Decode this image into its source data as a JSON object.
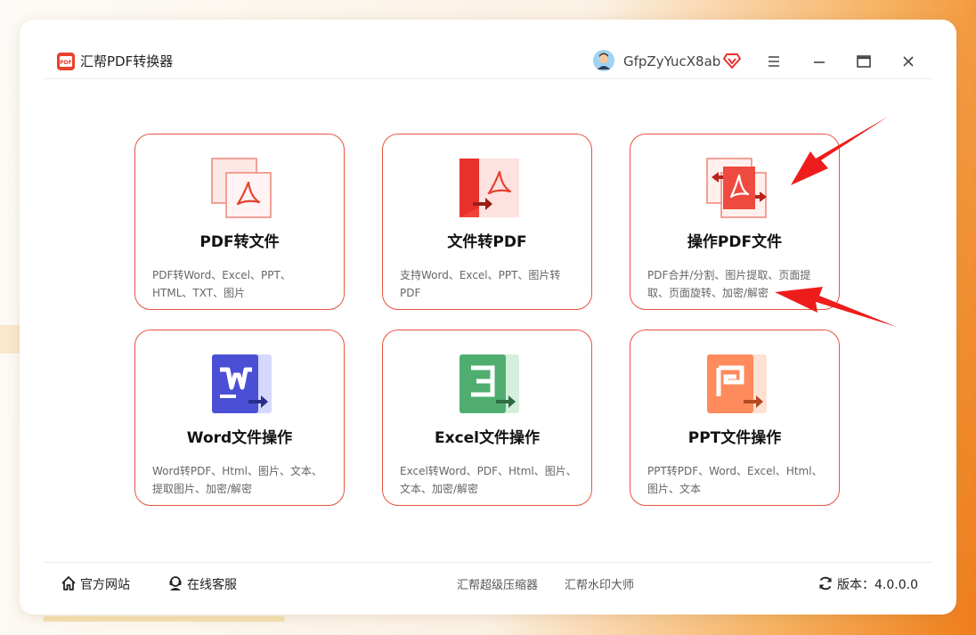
{
  "app": {
    "title": "汇帮PDF转换器",
    "logo_text": "PDF"
  },
  "user": {
    "name": "GfpZyYucX8ab"
  },
  "cards": [
    {
      "title": "PDF转文件",
      "desc": "PDF转Word、Excel、PPT、HTML、TXT、图片",
      "icon": "pdf-to-file-icon"
    },
    {
      "title": "文件转PDF",
      "desc": "支持Word、Excel、PPT、图片转PDF",
      "icon": "file-to-pdf-icon"
    },
    {
      "title": "操作PDF文件",
      "desc": "PDF合并/分割、图片提取、页面提取、页面旋转、加密/解密",
      "icon": "operate-pdf-icon"
    },
    {
      "title": "Word文件操作",
      "desc": "Word转PDF、Html、图片、文本、提取图片、加密/解密",
      "icon": "word-icon"
    },
    {
      "title": "Excel文件操作",
      "desc": "Excel转Word、PDF、Html、图片、文本、加密/解密",
      "icon": "excel-icon"
    },
    {
      "title": "PPT文件操作",
      "desc": "PPT转PDF、Word、Excel、Html、图片、文本",
      "icon": "ppt-icon"
    }
  ],
  "footer": {
    "website": "官方网站",
    "support": "在线客服",
    "link_compressor": "汇帮超级压缩器",
    "link_watermark": "汇帮水印大师",
    "version_label": "版本：",
    "version": "4.0.0.0"
  },
  "colors": {
    "accent": "#e8543d",
    "arrow": "#ee1c1c",
    "word_blue": "#4b4fd6",
    "excel_green": "#4fae6f",
    "ppt_orange": "#ff8a5b"
  }
}
